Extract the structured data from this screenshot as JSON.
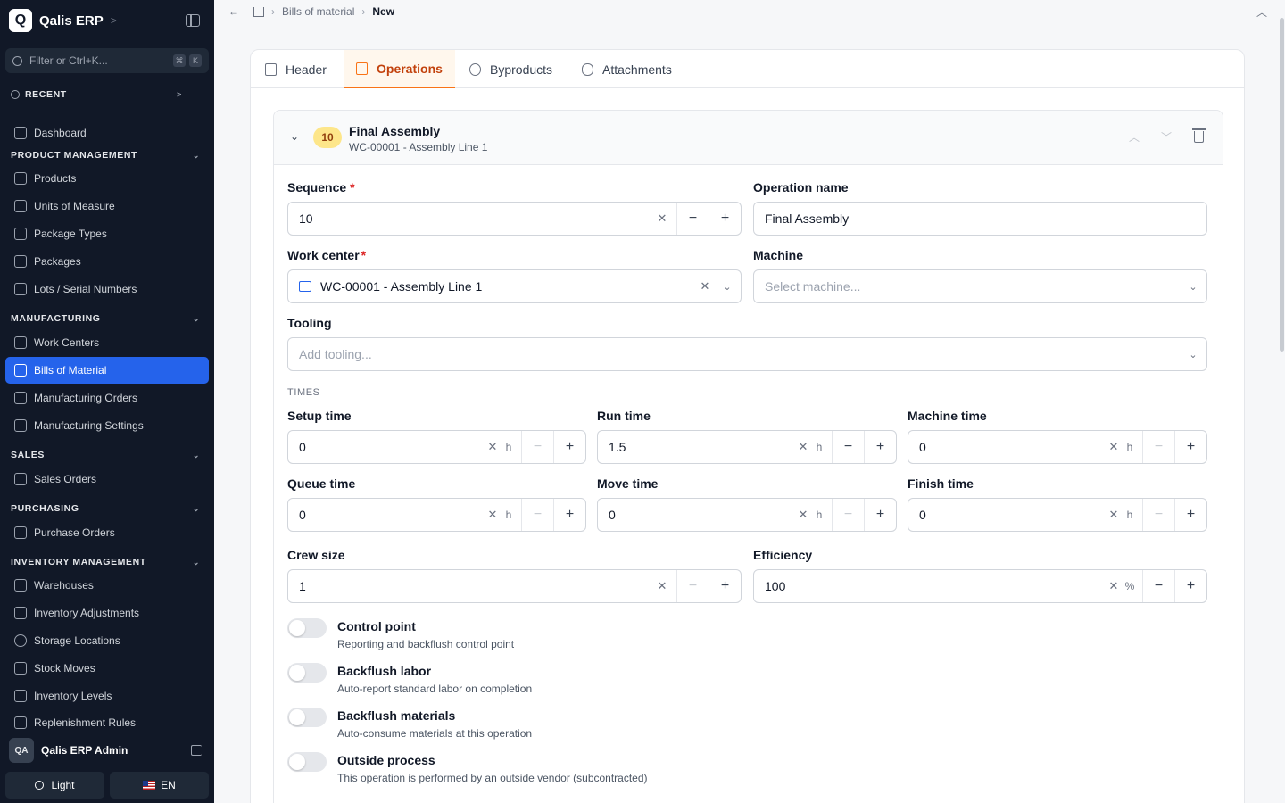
{
  "app": {
    "logo_letter": "Q",
    "name": "Qalis ERP"
  },
  "filter": {
    "placeholder": "Filter or Ctrl+K...",
    "kbd1": "⌘",
    "kbd2": "K"
  },
  "recent": "RECENT",
  "nav": {
    "dashboard": "Dashboard",
    "product_management": "PRODUCT MANAGEMENT",
    "products": "Products",
    "units": "Units of Measure",
    "package_types": "Package Types",
    "packages": "Packages",
    "lots": "Lots / Serial Numbers",
    "manufacturing": "MANUFACTURING",
    "work_centers": "Work Centers",
    "bom": "Bills of Material",
    "mfg_orders": "Manufacturing Orders",
    "mfg_settings": "Manufacturing Settings",
    "sales": "SALES",
    "sales_orders": "Sales Orders",
    "purchasing": "PURCHASING",
    "purchase_orders": "Purchase Orders",
    "inventory": "INVENTORY MANAGEMENT",
    "warehouses": "Warehouses",
    "inv_adjust": "Inventory Adjustments",
    "storage": "Storage Locations",
    "stock_moves": "Stock Moves",
    "inv_levels": "Inventory Levels",
    "replenishment": "Replenishment Rules"
  },
  "user": {
    "initials": "QA",
    "name": "Qalis ERP Admin"
  },
  "theme_label": "Light",
  "lang_label": "EN",
  "breadcrumb": {
    "parent": "Bills of material",
    "current": "New"
  },
  "tabs": {
    "header": "Header",
    "operations": "Operations",
    "byproducts": "Byproducts",
    "attachments": "Attachments"
  },
  "operation": {
    "seq_badge": "10",
    "title": "Final Assembly",
    "subtitle": "WC-00001 - Assembly Line 1"
  },
  "form": {
    "sequence_label": "Sequence",
    "sequence_value": "10",
    "opname_label": "Operation name",
    "opname_value": "Final Assembly",
    "workcenter_label": "Work center",
    "workcenter_value": "WC-00001 - Assembly Line 1",
    "machine_label": "Machine",
    "machine_placeholder": "Select machine...",
    "tooling_label": "Tooling",
    "tooling_placeholder": "Add tooling...",
    "times_section": "TIMES",
    "setup_label": "Setup time",
    "setup_value": "0",
    "run_label": "Run time",
    "run_value": "1.5",
    "machine_time_label": "Machine time",
    "machine_time_value": "0",
    "queue_label": "Queue time",
    "queue_value": "0",
    "move_label": "Move time",
    "move_value": "0",
    "finish_label": "Finish time",
    "finish_value": "0",
    "hour_unit": "h",
    "crew_label": "Crew size",
    "crew_value": "1",
    "eff_label": "Efficiency",
    "eff_value": "100",
    "eff_unit": "%"
  },
  "toggles": {
    "control_title": "Control point",
    "control_desc": "Reporting and backflush control point",
    "labor_title": "Backflush labor",
    "labor_desc": "Auto-report standard labor on completion",
    "materials_title": "Backflush materials",
    "materials_desc": "Auto-consume materials at this operation",
    "outside_title": "Outside process",
    "outside_desc": "This operation is performed by an outside vendor (subcontracted)"
  }
}
